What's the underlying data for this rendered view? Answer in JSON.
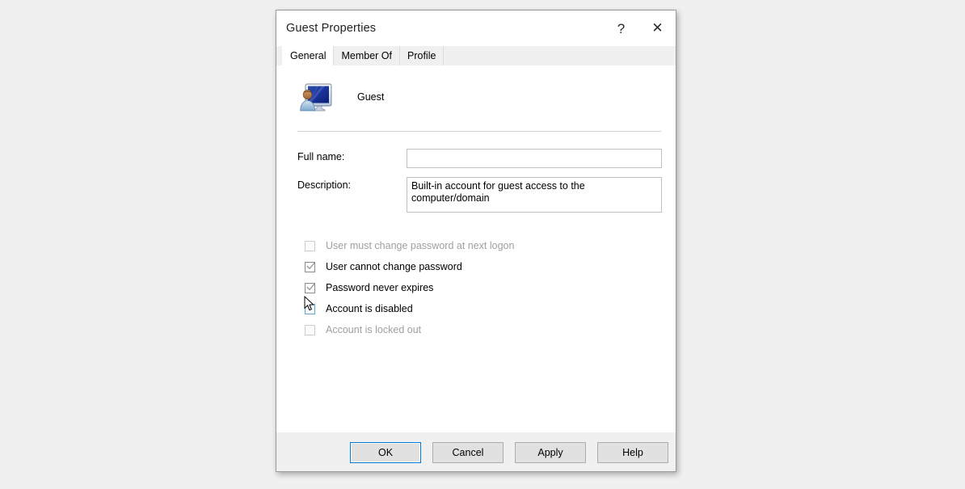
{
  "window": {
    "title": "Guest Properties",
    "help_icon": "question-mark-icon",
    "help_label": "?",
    "close_icon": "close-icon",
    "close_label": "✕"
  },
  "tabs": [
    {
      "label": "General",
      "active": true
    },
    {
      "label": "Member Of",
      "active": false
    },
    {
      "label": "Profile",
      "active": false
    }
  ],
  "account": {
    "icon": "user-computer-icon",
    "name": "Guest"
  },
  "fields": [
    {
      "label": "Full name:",
      "value": "",
      "type": "input"
    },
    {
      "label": "Description:",
      "value": "Built-in account for guest access to the computer/domain",
      "type": "textarea"
    }
  ],
  "checkboxes": [
    {
      "label": "User must change password at next logon",
      "checked": false,
      "disabled": true,
      "hovered": false
    },
    {
      "label": "User cannot change password",
      "checked": true,
      "disabled": false,
      "hovered": false
    },
    {
      "label": "Password never expires",
      "checked": true,
      "disabled": false,
      "hovered": false
    },
    {
      "label": "Account is disabled",
      "checked": false,
      "disabled": false,
      "hovered": true
    },
    {
      "label": "Account is locked out",
      "checked": false,
      "disabled": true,
      "hovered": false
    }
  ],
  "buttons": [
    {
      "label": "OK",
      "default": true
    },
    {
      "label": "Cancel",
      "default": false
    },
    {
      "label": "Apply",
      "default": false
    },
    {
      "label": "Help",
      "default": false
    }
  ],
  "colors": {
    "desktop_background": "#f0f0f0",
    "dialog_background": "#ffffff",
    "accent": "#0078d7",
    "hover_checkbox_border": "#5ea5d6",
    "disabled_text": "#a0a0a0"
  }
}
